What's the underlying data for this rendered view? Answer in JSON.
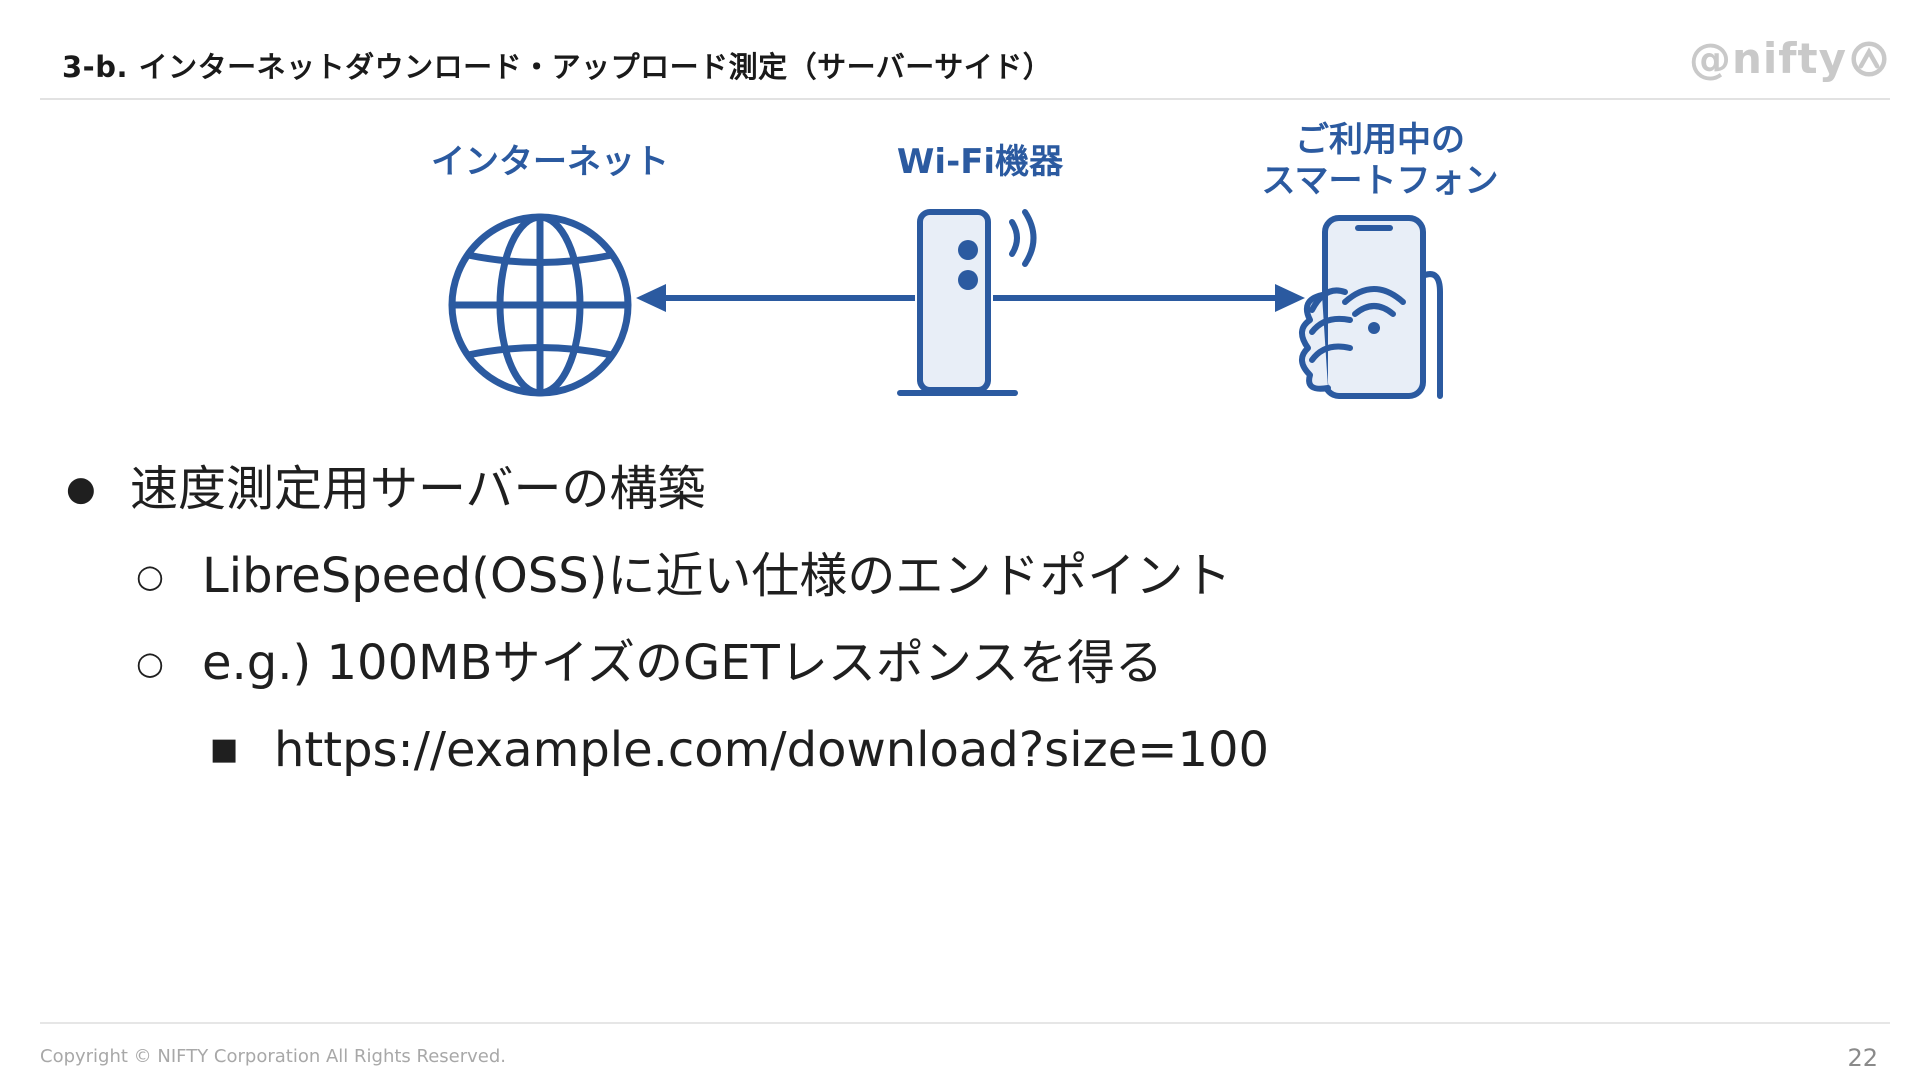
{
  "header": {
    "title": "3-b. インターネットダウンロード・アップロード測定（サーバーサイド）",
    "logo_text": "@nifty"
  },
  "diagram": {
    "internet_label": "インターネット",
    "wifi_label": "Wi-Fi機器",
    "phone_label_line1": "ご利用中の",
    "phone_label_line2": "スマートフォン",
    "accent_color": "#2b5aa0",
    "fill_color": "#e8eef7"
  },
  "bullets": [
    {
      "level": 1,
      "marker": "●",
      "text": "速度測定用サーバーの構築"
    },
    {
      "level": 2,
      "marker": "○",
      "text": "LibreSpeed(OSS)に近い仕様のエンドポイント"
    },
    {
      "level": 2,
      "marker": "○",
      "text": "e.g.) 100MBサイズのGETレスポンスを得る"
    },
    {
      "level": 3,
      "marker": "■",
      "text": "https://example.com/download?size=100"
    }
  ],
  "footer": {
    "copyright": "Copyright © NIFTY Corporation All Rights Reserved.",
    "page_number": "22"
  }
}
